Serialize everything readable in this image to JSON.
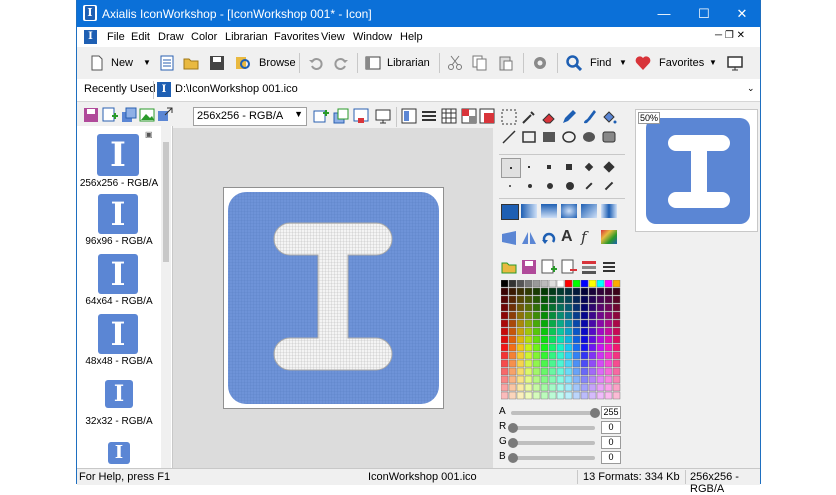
{
  "window": {
    "title": "Axialis IconWorkshop - [IconWorkshop 001* - Icon]",
    "controls": [
      "—",
      "☐",
      "✕"
    ]
  },
  "menu": [
    "File",
    "Edit",
    "Draw",
    "Color",
    "Librarian",
    "Favorites",
    "View",
    "Window",
    "Help"
  ],
  "toolbar": {
    "new_label": "New",
    "browse_label": "Browse",
    "librarian_label": "Librarian",
    "find_label": "Find",
    "favorites_label": "Favorites"
  },
  "address": {
    "recently_used_label": "Recently Used",
    "path": "D:\\IconWorkshop 001.ico"
  },
  "editor": {
    "format_select": "256x256 - RGB/A"
  },
  "formats": [
    {
      "label": "256x256 - RGB/A"
    },
    {
      "label": "96x96 - RGB/A"
    },
    {
      "label": "64x64 - RGB/A"
    },
    {
      "label": "48x48 - RGB/A"
    },
    {
      "label": "32x32 - RGB/A"
    }
  ],
  "preview": {
    "zoom_label": "50%"
  },
  "sliders": [
    {
      "label": "A",
      "value": "255",
      "level": 1.0
    },
    {
      "label": "R",
      "value": "0",
      "level": 0
    },
    {
      "label": "G",
      "value": "0",
      "level": 0
    },
    {
      "label": "B",
      "value": "0",
      "level": 0
    }
  ],
  "status": {
    "help": "For Help, press F1",
    "file": "IconWorkshop 001.ico",
    "formats": "13 Formats: 334 Kb",
    "current_format": "256x256 - RGB/A"
  },
  "colors": {
    "title_bar": "#0b70d8",
    "icon_blue": "#5b86d4",
    "favorites_heart": "#d8343a",
    "find_glass": "#1e5fb3"
  },
  "icons": [
    "app-icon",
    "new-icon",
    "open-icon",
    "save-icon",
    "browse-icon",
    "undo-icon",
    "redo-icon",
    "librarian-icon",
    "cut-icon",
    "copy-icon",
    "paste-icon",
    "settings-icon",
    "find-icon",
    "favorites-heart-icon",
    "monitor-icon"
  ]
}
